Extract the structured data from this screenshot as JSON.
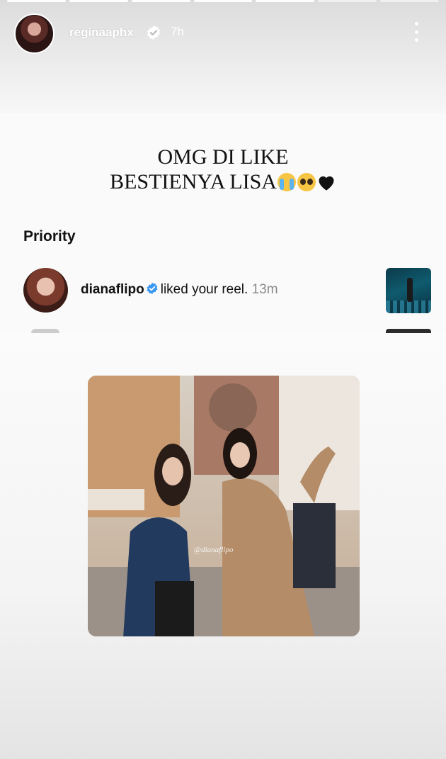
{
  "story": {
    "progress": {
      "segments_total": 7,
      "segments_done": 5
    },
    "header": {
      "username": "reginaaphx",
      "verified": true,
      "time": "7h",
      "more_icon": "more-vertical-icon"
    },
    "caption": {
      "line1": "OMG DI LIKE",
      "line2": "BESTIENYA LISA",
      "emojis": [
        "loudly-crying-face",
        "pleading-face",
        "black-heart"
      ]
    }
  },
  "notifications": {
    "section_title": "Priority",
    "items": [
      {
        "username": "dianaflipo",
        "verified": true,
        "action": "liked your reel.",
        "time": "13m",
        "thumbnail_icon": "reel-thumbnail"
      }
    ]
  },
  "photo": {
    "watermark": "@dianaflipo"
  },
  "colors": {
    "verified_blue": "#3897f0",
    "text_primary": "#111111",
    "text_secondary": "#8a8a8a"
  }
}
